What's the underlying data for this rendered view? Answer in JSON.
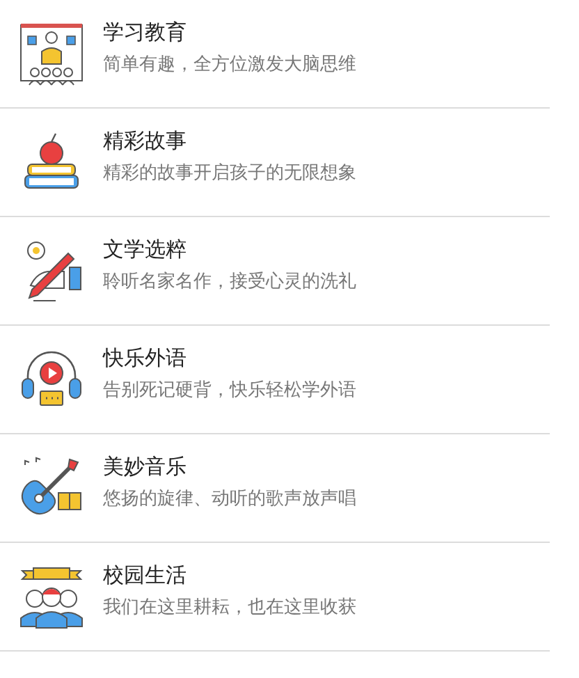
{
  "items": [
    {
      "kind": "classroom",
      "title": "学习教育",
      "subtitle": "简单有趣，全方位激发大脑思维"
    },
    {
      "kind": "books",
      "title": "精彩故事",
      "subtitle": "精彩的故事开启孩子的无限想象"
    },
    {
      "kind": "writing",
      "title": "文学选粹",
      "subtitle": "聆听名家名作，接受心灵的洗礼"
    },
    {
      "kind": "headphones",
      "title": "快乐外语",
      "subtitle": "告别死记硬背，快乐轻松学外语"
    },
    {
      "kind": "guitar",
      "title": "美妙音乐",
      "subtitle": "悠扬的旋律、动听的歌声放声唱"
    },
    {
      "kind": "students",
      "title": "校园生活",
      "subtitle": "我们在这里耕耘，也在这里收获"
    }
  ]
}
